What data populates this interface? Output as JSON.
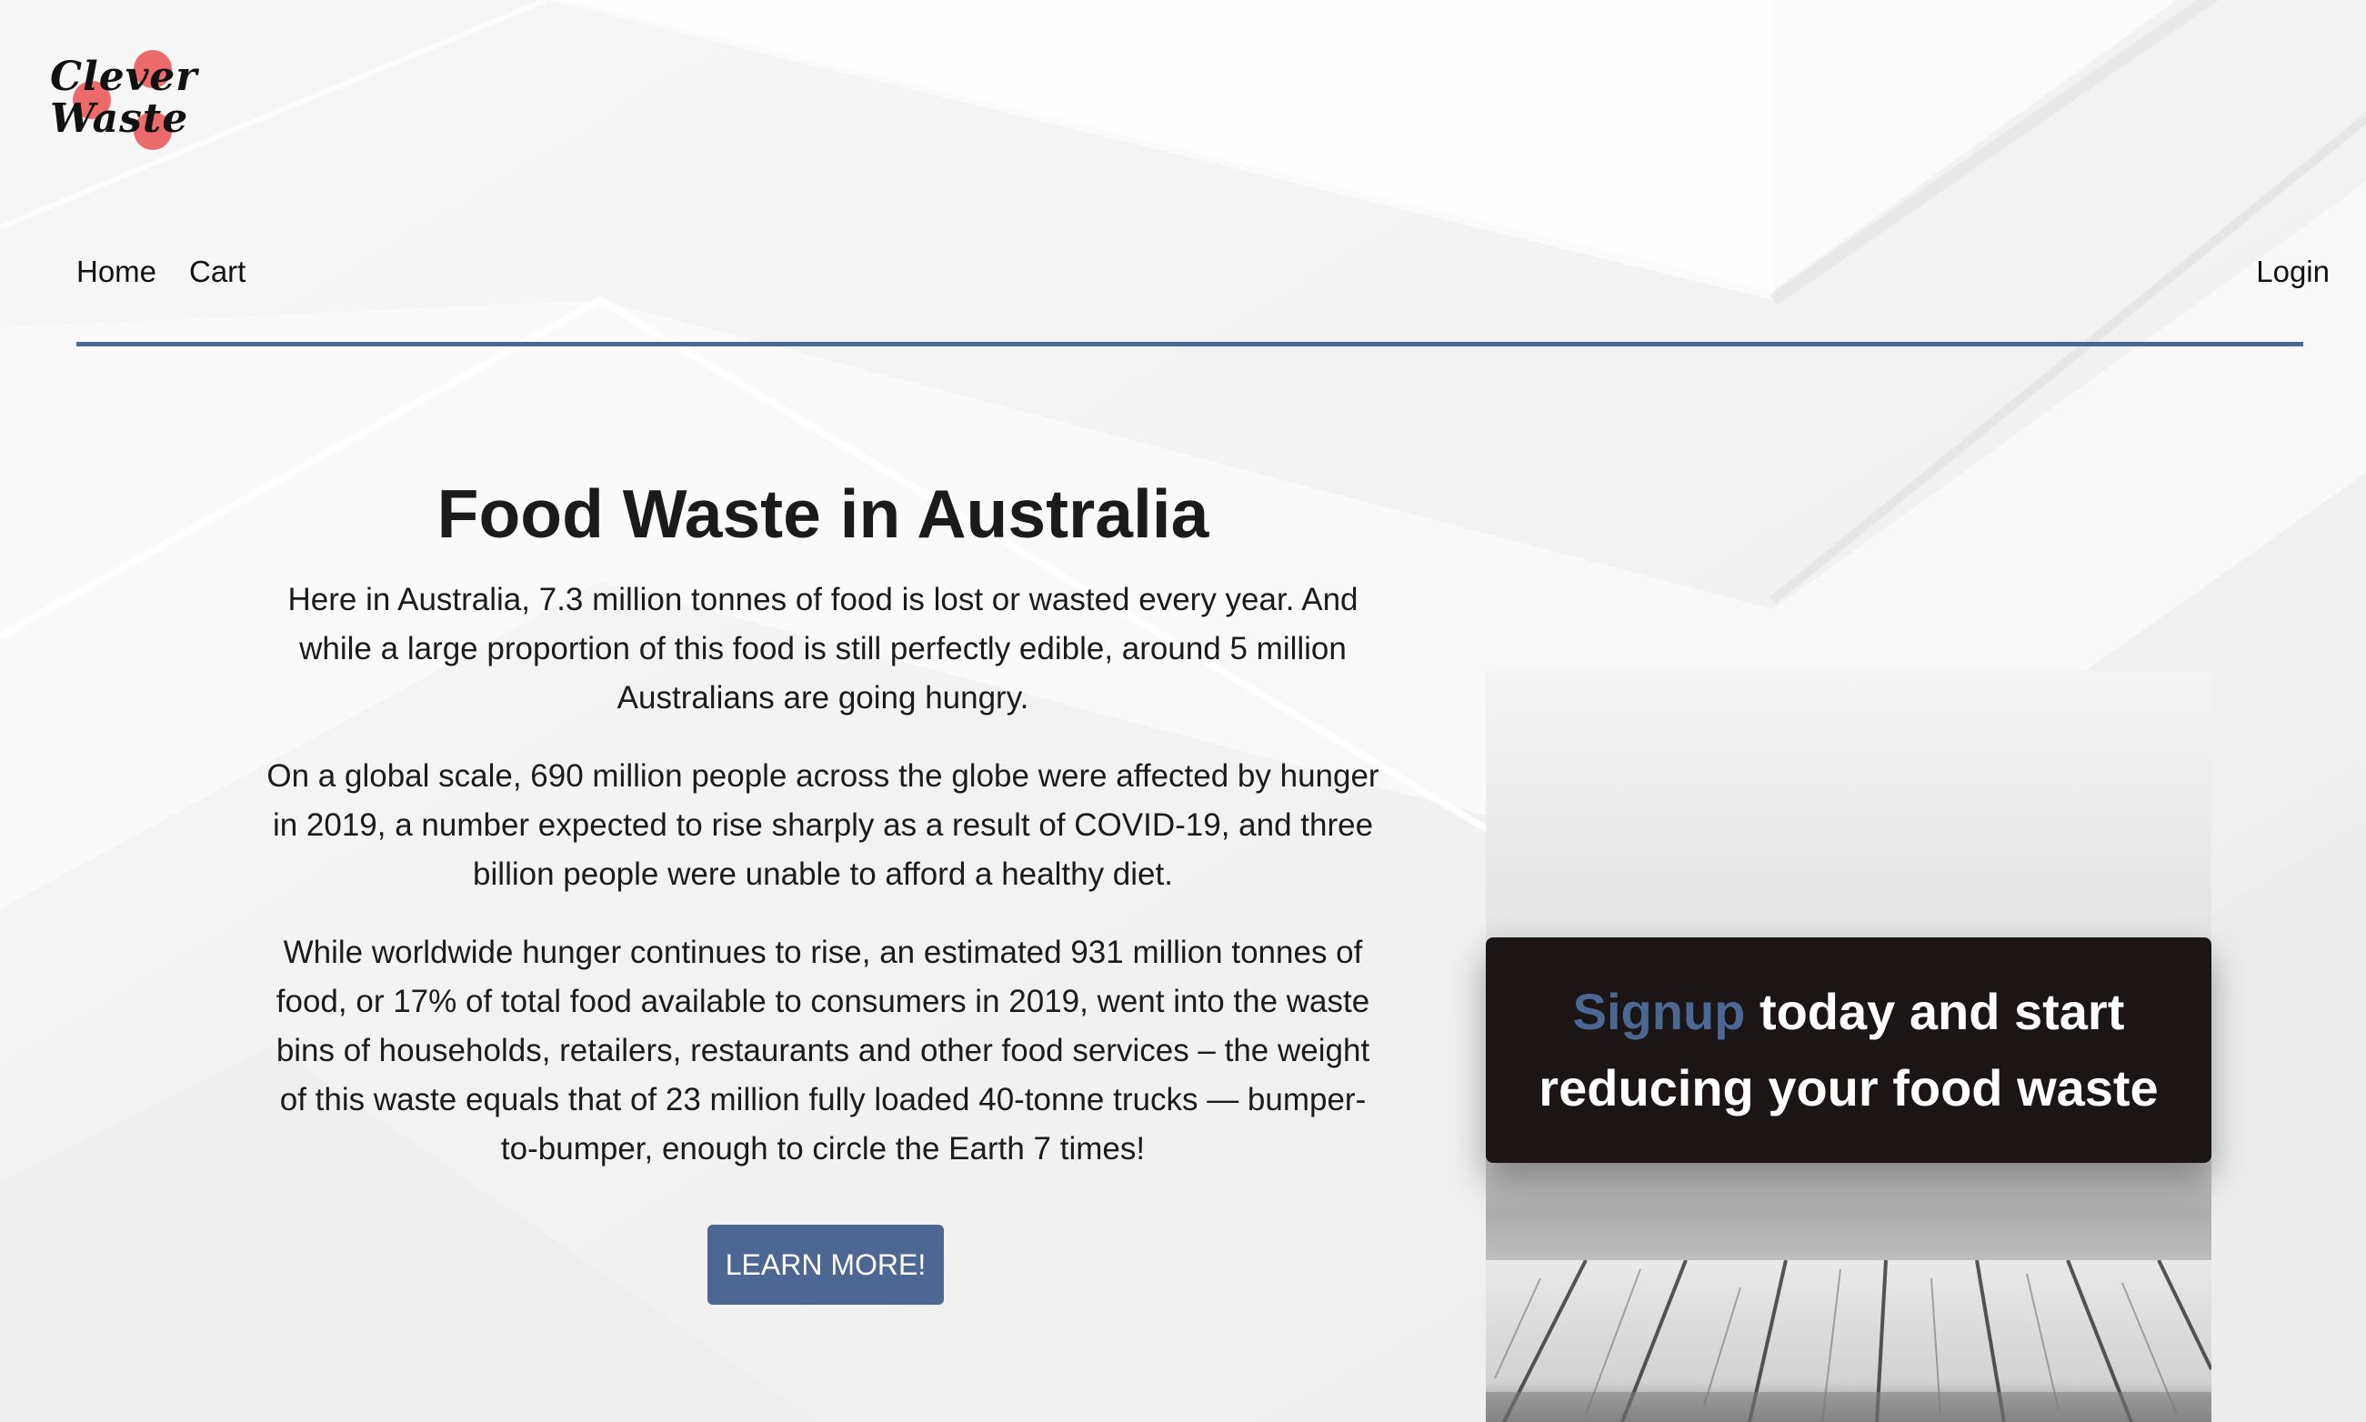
{
  "brand": {
    "logo_line1": "Clever",
    "logo_line2": "Waste",
    "accent_color": "#4c6892",
    "logo_color": "#ec6a6a"
  },
  "nav": {
    "items": [
      {
        "label": "Home"
      },
      {
        "label": "Cart"
      }
    ],
    "login_label": "Login"
  },
  "main": {
    "title": "Food Waste in Australia",
    "paragraphs": [
      "Here in Australia, 7.3 million tonnes of food is lost or wasted every year. And while a large proportion of this food is still perfectly edible, around 5 million Australians are going hungry.",
      "On a global scale, 690 million people across the globe were affected by hunger in 2019, a number expected to rise sharply as a result of COVID-19, and three billion people were unable to afford a healthy diet.",
      "While worldwide hunger continues to rise, an estimated 931 million tonnes of food, or 17% of total food available to consumers in 2019, went into the waste bins of households, retailers, restaurants and other food services – the weight of this waste equals that of 23 million fully loaded 40-tonne trucks — bumper-to-bumper, enough to circle the Earth 7 times!"
    ],
    "cta_label": "LEARN MORE!"
  },
  "signup": {
    "highlight": "Signup",
    "rest_line1": " today and start",
    "line2": "reducing your food waste"
  }
}
